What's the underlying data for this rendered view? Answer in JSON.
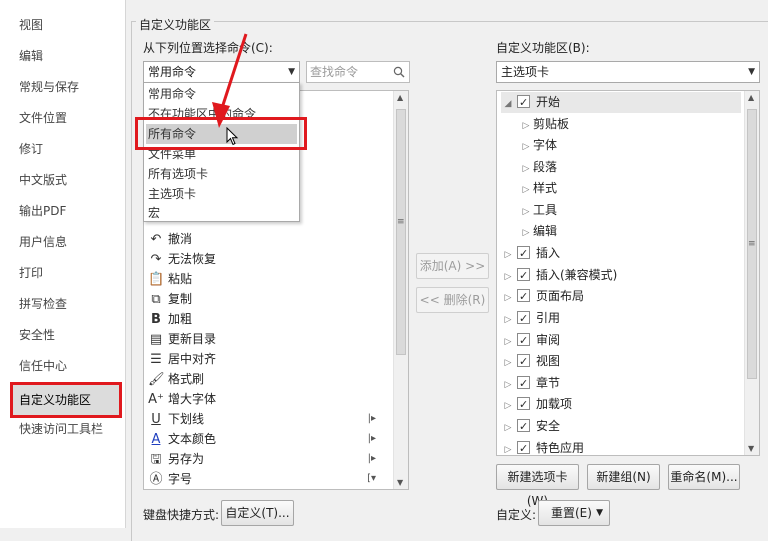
{
  "sidebar": {
    "items": [
      {
        "label": "视图"
      },
      {
        "label": "编辑"
      },
      {
        "label": "常规与保存"
      },
      {
        "label": "文件位置"
      },
      {
        "label": "修订"
      },
      {
        "label": "中文版式"
      },
      {
        "label": "输出PDF"
      },
      {
        "label": "用户信息"
      },
      {
        "label": "打印"
      },
      {
        "label": "拼写检查"
      },
      {
        "label": "安全性"
      },
      {
        "label": "信任中心"
      },
      {
        "label": "自定义功能区"
      },
      {
        "label": "快速访问工具栏"
      }
    ],
    "active_index": 12
  },
  "group_title": "自定义功能区",
  "left": {
    "choose_label": "从下列位置选择命令(C):",
    "combo_value": "常用命令",
    "search_placeholder": "查找命令",
    "dropdown_options": [
      "常用命令",
      "不在功能区中的命令",
      "所有命令",
      "文件菜单",
      "所有选项卡",
      "主选项卡",
      "宏"
    ],
    "dropdown_selected_index": 2,
    "commands": [
      {
        "icon": "↶",
        "label": "撤消"
      },
      {
        "icon": "↷",
        "label": "无法恢复"
      },
      {
        "icon": "📋",
        "label": "粘贴"
      },
      {
        "icon": "⧉",
        "label": "复制"
      },
      {
        "icon": "B",
        "label": "加粗"
      },
      {
        "icon": "▤",
        "label": "更新目录"
      },
      {
        "icon": "☰",
        "label": "居中对齐"
      },
      {
        "icon": "🖌",
        "label": "格式刷"
      },
      {
        "icon": "A⁺",
        "label": "增大字体"
      },
      {
        "icon": "U",
        "label": "下划线",
        "sub": "|▸"
      },
      {
        "icon": "A",
        "label": "文本颜色",
        "sub": "|▸"
      },
      {
        "icon": "🖫",
        "label": "另存为",
        "sub": "|▸"
      },
      {
        "icon": "Ⓐ",
        "label": "字号",
        "sub": "[▾"
      }
    ],
    "shortcut_label": "键盘快捷方式:",
    "shortcut_button": "自定义(T)..."
  },
  "middle": {
    "add_button": "添加(A) >>",
    "remove_button": "<< 删除(R)"
  },
  "right": {
    "customize_label": "自定义功能区(B):",
    "combo_value": "主选项卡",
    "tree": [
      {
        "label": "开始",
        "level": 0,
        "expanded": true,
        "checked": true
      },
      {
        "label": "剪贴板",
        "level": 1
      },
      {
        "label": "字体",
        "level": 1
      },
      {
        "label": "段落",
        "level": 1
      },
      {
        "label": "样式",
        "level": 1
      },
      {
        "label": "工具",
        "level": 1
      },
      {
        "label": "编辑",
        "level": 1
      },
      {
        "label": "插入",
        "level": 0,
        "checked": true
      },
      {
        "label": "插入(兼容模式)",
        "level": 0,
        "checked": true
      },
      {
        "label": "页面布局",
        "level": 0,
        "checked": true
      },
      {
        "label": "引用",
        "level": 0,
        "checked": true
      },
      {
        "label": "审阅",
        "level": 0,
        "checked": true
      },
      {
        "label": "视图",
        "level": 0,
        "checked": true
      },
      {
        "label": "章节",
        "level": 0,
        "checked": true
      },
      {
        "label": "加载项",
        "level": 0,
        "checked": true
      },
      {
        "label": "安全",
        "level": 0,
        "checked": true
      },
      {
        "label": "特色应用",
        "level": 0,
        "checked": true
      }
    ],
    "new_tab_button": "新建选项卡(W)",
    "new_group_button": "新建组(N)",
    "rename_button": "重命名(M)...",
    "customize_label2": "自定义:",
    "reset_button": "重置(E)"
  },
  "colors": {
    "highlight": "#e0191e",
    "arrow": "#e0191e"
  }
}
